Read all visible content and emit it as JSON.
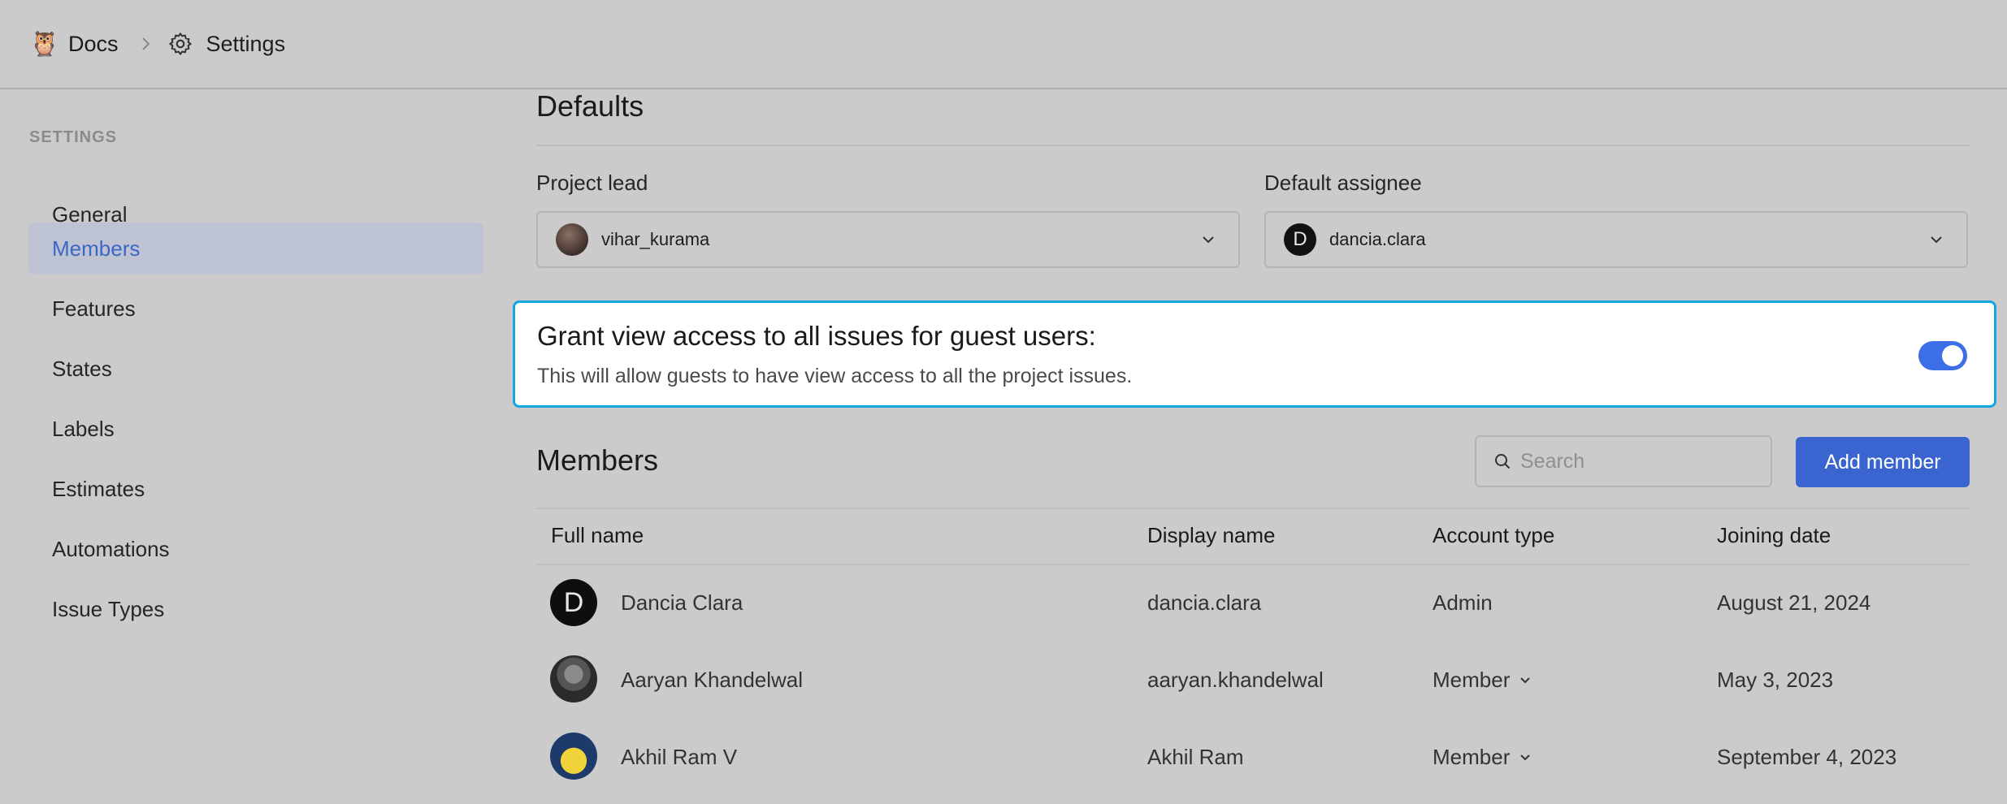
{
  "breadcrumb": {
    "project_icon": "owl-emoji",
    "project": "Docs",
    "settings_icon": "gear-icon",
    "page": "Settings"
  },
  "sidebar": {
    "heading": "SETTINGS",
    "items": [
      {
        "label": "General",
        "active": false
      },
      {
        "label": "Members",
        "active": true
      },
      {
        "label": "Features",
        "active": false
      },
      {
        "label": "States",
        "active": false
      },
      {
        "label": "Labels",
        "active": false
      },
      {
        "label": "Estimates",
        "active": false
      },
      {
        "label": "Automations",
        "active": false
      },
      {
        "label": "Issue Types",
        "active": false
      }
    ]
  },
  "defaults": {
    "title": "Defaults",
    "project_lead": {
      "label": "Project lead",
      "value": "vihar_kurama"
    },
    "default_assignee": {
      "label": "Default assignee",
      "value": "dancia.clara",
      "avatar_letter": "D"
    }
  },
  "guest_access": {
    "title": "Grant view access to all issues for guest users:",
    "description": "This will allow guests to have view access to all the project issues.",
    "enabled": true,
    "highlight_color": "#14a8dc"
  },
  "members": {
    "title": "Members",
    "search_placeholder": "Search",
    "add_label": "Add member",
    "columns": [
      "Full name",
      "Display name",
      "Account type",
      "Joining date"
    ],
    "rows": [
      {
        "full_name": "Dancia Clara",
        "display_name": "dancia.clara",
        "account_type": "Admin",
        "joining_date": "August 21, 2024",
        "avatar_letter": "D",
        "editable": false
      },
      {
        "full_name": "Aaryan Khandelwal",
        "display_name": "aaryan.khandelwal",
        "account_type": "Member",
        "joining_date": "May 3, 2023",
        "avatar_letter": "",
        "editable": true
      },
      {
        "full_name": "Akhil Ram V",
        "display_name": "Akhil Ram",
        "account_type": "Member",
        "joining_date": "September 4, 2023",
        "avatar_letter": "",
        "editable": true
      }
    ]
  },
  "colors": {
    "accent": "#3a64d0",
    "toggle_on": "#3c6ee6",
    "active_nav_bg": "#bdc3d3",
    "active_nav_text": "#3e66c6"
  }
}
